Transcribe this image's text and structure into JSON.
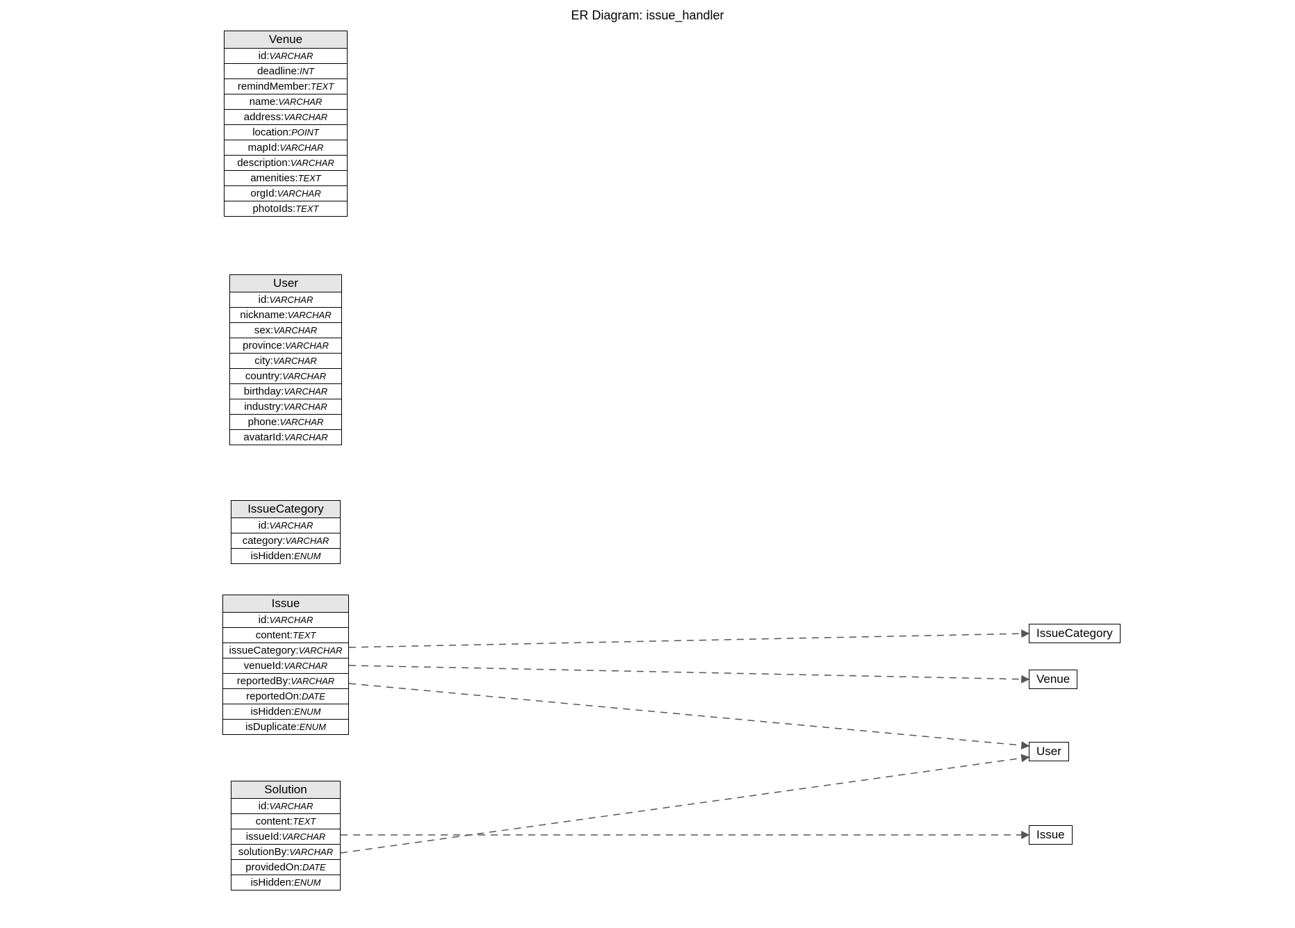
{
  "title": "ER Diagram: issue_handler",
  "entities": {
    "venue": {
      "name": "Venue",
      "fields": [
        {
          "name": "id",
          "type": "VARCHAR"
        },
        {
          "name": "deadline",
          "type": "INT"
        },
        {
          "name": "remindMember",
          "type": "TEXT"
        },
        {
          "name": "name",
          "type": "VARCHAR"
        },
        {
          "name": "address",
          "type": "VARCHAR"
        },
        {
          "name": "location",
          "type": "POINT"
        },
        {
          "name": "mapId",
          "type": "VARCHAR"
        },
        {
          "name": "description",
          "type": "VARCHAR"
        },
        {
          "name": "amenities",
          "type": "TEXT"
        },
        {
          "name": "orgId",
          "type": "VARCHAR"
        },
        {
          "name": "photoIds",
          "type": "TEXT"
        }
      ]
    },
    "user": {
      "name": "User",
      "fields": [
        {
          "name": "id",
          "type": "VARCHAR"
        },
        {
          "name": "nickname",
          "type": "VARCHAR"
        },
        {
          "name": "sex",
          "type": "VARCHAR"
        },
        {
          "name": "province",
          "type": "VARCHAR"
        },
        {
          "name": "city",
          "type": "VARCHAR"
        },
        {
          "name": "country",
          "type": "VARCHAR"
        },
        {
          "name": "birthday",
          "type": "VARCHAR"
        },
        {
          "name": "industry",
          "type": "VARCHAR"
        },
        {
          "name": "phone",
          "type": "VARCHAR"
        },
        {
          "name": "avatarId",
          "type": "VARCHAR"
        }
      ]
    },
    "issueCategory": {
      "name": "IssueCategory",
      "fields": [
        {
          "name": "id",
          "type": "VARCHAR"
        },
        {
          "name": "category",
          "type": "VARCHAR"
        },
        {
          "name": "isHidden",
          "type": "ENUM"
        }
      ]
    },
    "issue": {
      "name": "Issue",
      "fields": [
        {
          "name": "id",
          "type": "VARCHAR"
        },
        {
          "name": "content",
          "type": "TEXT"
        },
        {
          "name": "issueCategory",
          "type": "VARCHAR"
        },
        {
          "name": "venueId",
          "type": "VARCHAR"
        },
        {
          "name": "reportedBy",
          "type": "VARCHAR"
        },
        {
          "name": "reportedOn",
          "type": "DATE"
        },
        {
          "name": "isHidden",
          "type": "ENUM"
        },
        {
          "name": "isDuplicate",
          "type": "ENUM"
        }
      ]
    },
    "solution": {
      "name": "Solution",
      "fields": [
        {
          "name": "id",
          "type": "VARCHAR"
        },
        {
          "name": "content",
          "type": "TEXT"
        },
        {
          "name": "issueId",
          "type": "VARCHAR"
        },
        {
          "name": "solutionBy",
          "type": "VARCHAR"
        },
        {
          "name": "providedOn",
          "type": "DATE"
        },
        {
          "name": "isHidden",
          "type": "ENUM"
        }
      ]
    }
  },
  "refs": {
    "issueCategory": "IssueCategory",
    "venue": "Venue",
    "user": "User",
    "issue": "Issue"
  }
}
